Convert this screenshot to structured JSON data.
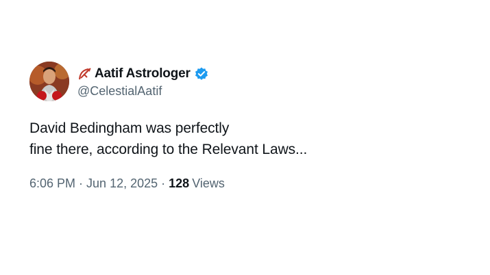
{
  "author": {
    "display_name": "Aatif Astrologer",
    "handle": "@CelestialAatif",
    "name_emoji_icon": "sagittarius-bow-icon",
    "verified_icon": "verified-badge-icon",
    "verified_color": "#1d9bf0"
  },
  "tweet": {
    "text_line_1": "David Bedingham was perfectly",
    "text_line_2": "fine there, according to the Relevant Laws..."
  },
  "meta": {
    "time": "6:06 PM",
    "separator_1": "·",
    "date": "Jun 12, 2025",
    "separator_2": "·",
    "views_count": "128",
    "views_label": "Views"
  }
}
